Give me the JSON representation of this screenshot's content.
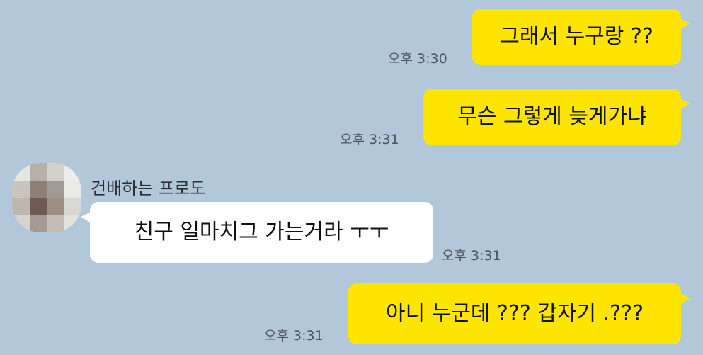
{
  "messages": [
    {
      "sender": "me",
      "text": "그래서 누구랑 ??",
      "time": "오후 3:30"
    },
    {
      "sender": "me",
      "text": "무슨 그렇게 늦게가냐",
      "time": "오후 3:31"
    },
    {
      "sender": "other",
      "name": "건배하는 프로도",
      "text": "친구 일마치그 가는거라 ㅜㅜ",
      "time": "오후 3:31"
    },
    {
      "sender": "me",
      "text": "아니 누군데 ??? 갑자기 .???",
      "time": "오후 3:31"
    }
  ],
  "colors": {
    "background": "#b2c7d9",
    "my_bubble": "#fee500",
    "their_bubble": "#ffffff"
  },
  "icons": {
    "profile": "blurred-profile-photo"
  }
}
